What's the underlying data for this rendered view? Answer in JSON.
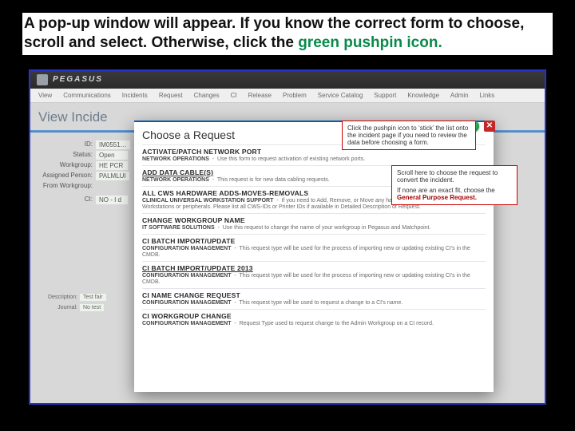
{
  "instruction": {
    "part1": "A pop-up window will appear. If you know the correct form to choose, scroll and select. Otherwise, click the ",
    "green1": "green",
    "part2": " ",
    "green2": "pushpin icon.",
    "part3": ""
  },
  "app": {
    "brand": "PEGASUS",
    "menu": [
      "View",
      "Communications",
      "Incidents",
      "Request",
      "Changes",
      "CI",
      "Release",
      "Problem",
      "Service Catalog",
      "Support",
      "Knowledge",
      "Admin",
      "Links"
    ],
    "page_title": "View Incide",
    "fields": {
      "id_label": "ID:",
      "id_val": "IM0551…",
      "status_label": "Status:",
      "status_val": "Open",
      "workgroup_label": "Workgroup:",
      "workgroup_val": "HE PCR",
      "assigned_label": "Assigned Person:",
      "assigned_val": "PALMLUI",
      "from_label": "From Workgroup:",
      "ci_label": "CI:",
      "ci_val": "NO - I d",
      "descr_label": "Description:",
      "descr_val": "Test fair",
      "journal_label": "Journal:",
      "journal_val": "No test"
    }
  },
  "modal": {
    "title": "Choose a Request",
    "requests": [
      {
        "title": "ACTIVATE/PATCH NETWORK PORT",
        "sub_group": "NETWORK OPERATIONS",
        "sub_text": "Use this form to request activation of existing network ports."
      },
      {
        "title": "ADD DATA CABLE(S)",
        "underline": true,
        "sub_group": "NETWORK OPERATIONS",
        "sub_text": "This request is for new data cabling requests."
      },
      {
        "title": "ALL CWS HARDWARE ADDS-MOVES-REMOVALS",
        "sub_group": "CLINICAL UNIVERSAL WORKSTATION SUPPORT",
        "sub_text": "If you need to Add, Remove, or Move any hardware related to the Clinical Workstations or peripherals. Please list all CWS-IDs or Printer IDs if available in Detailed Description of Request."
      },
      {
        "title": "CHANGE WORKGROUP NAME",
        "sub_group": "IT SOFTWARE SOLUTIONS",
        "sub_text": "Use this request to change the name of your workgroup in Pegasus and Matchpoint."
      },
      {
        "title": "CI BATCH IMPORT/UPDATE",
        "sub_group": "CONFIGURATION MANAGEMENT",
        "sub_text": "This request type will be used for the process of importing new or updating existing CI's in the CMDB."
      },
      {
        "title": "CI BATCH IMPORT/UPDATE 2013",
        "underline": true,
        "sub_group": "CONFIGURATION MANAGEMENT",
        "sub_text": "This request type will be used for the process of importing new or updating existing CI's in the CMDB."
      },
      {
        "title": "CI NAME CHANGE REQUEST",
        "sub_group": "CONFIGURATION MANAGEMENT",
        "sub_text": "This request type will be used to request a change to a CI's name."
      },
      {
        "title": "CI WORKGROUP CHANGE",
        "sub_group": "CONFIGURATION MANAGEMENT",
        "sub_text": "Request Type used to request change to the Admin Workgroup on a CI record."
      }
    ]
  },
  "callouts": {
    "c1": "Click the pushpin icon to ‘stick’ the list onto the incident page if you need to review the data before choosing a form.",
    "c2_l1": "Scroll here to choose the request to convert the incident.",
    "c2_l2": "If none are an exact fit, choose the",
    "c2_l3": "General Purpose Request."
  },
  "icons": {
    "pin": "pushpin-icon",
    "close": "close-icon"
  }
}
